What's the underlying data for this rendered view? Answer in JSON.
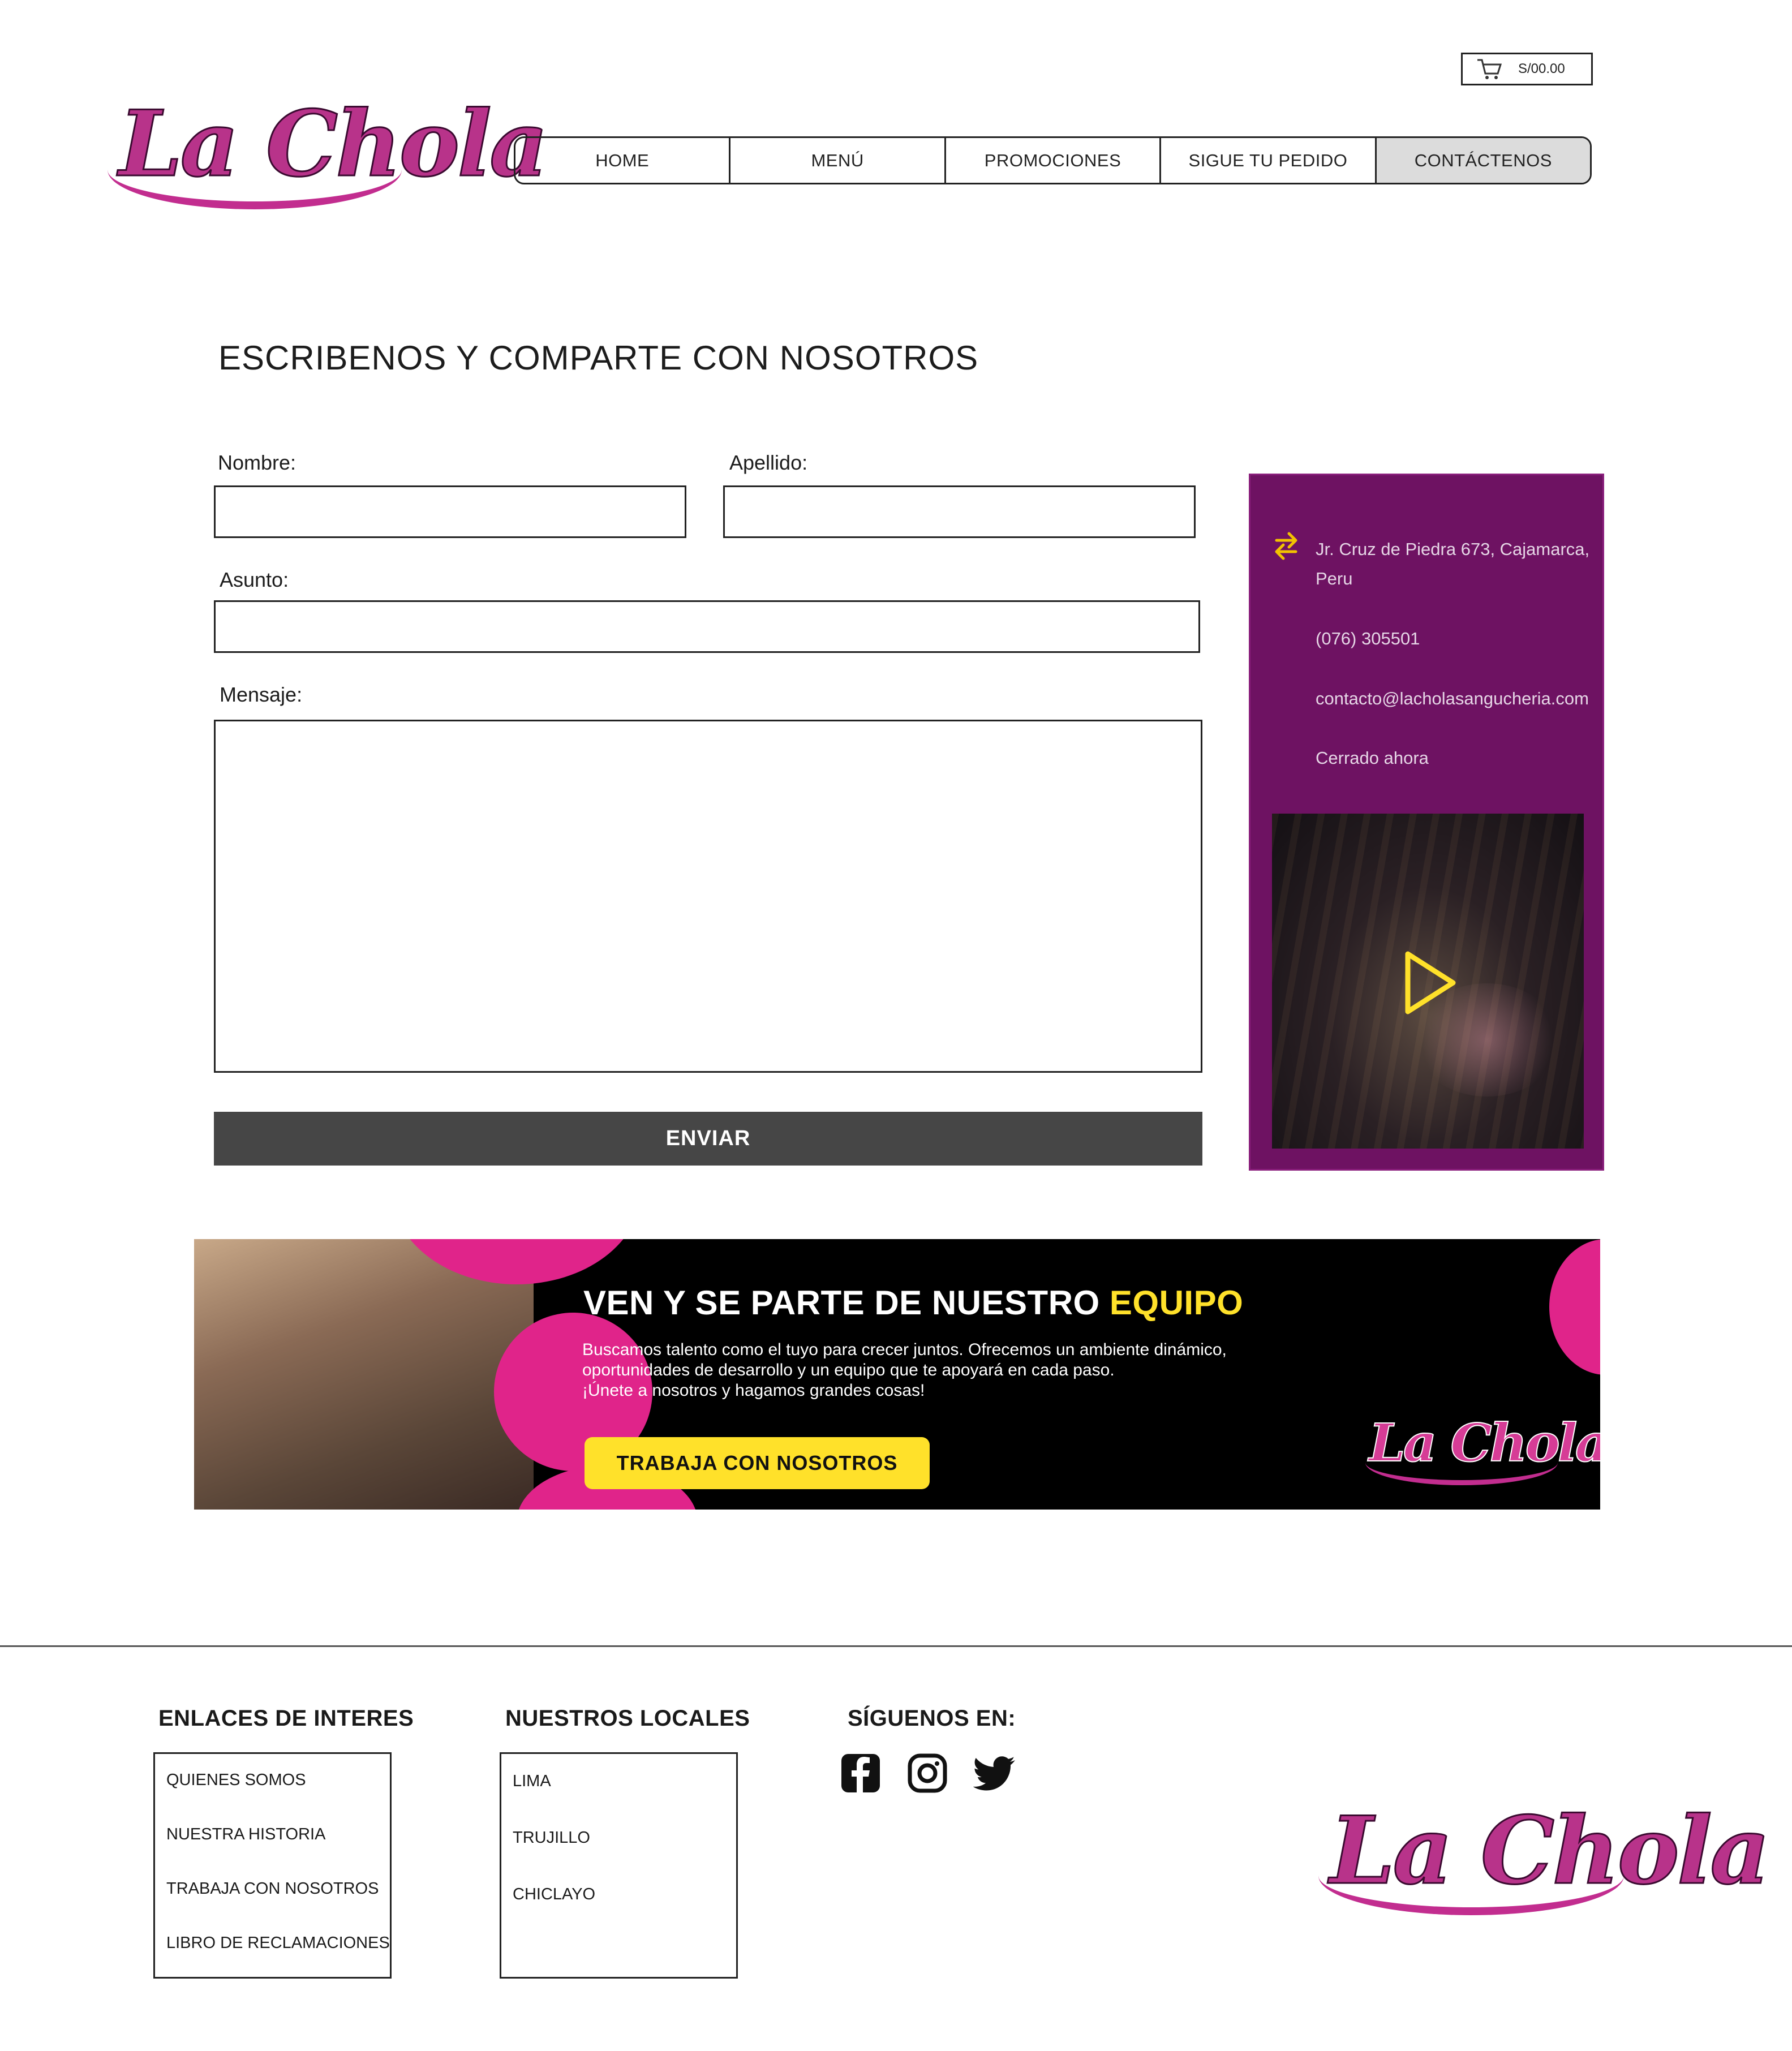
{
  "brand": {
    "logo_text": "La Chola"
  },
  "cart": {
    "amount": "S/00.00",
    "icon": "cart-icon"
  },
  "nav": {
    "items": [
      {
        "label": "HOME"
      },
      {
        "label": "MENÚ"
      },
      {
        "label": "PROMOCIONES"
      },
      {
        "label": "SIGUE TU PEDIDO"
      },
      {
        "label": "CONTÁCTENOS"
      }
    ],
    "active_index": 4
  },
  "form": {
    "title": "ESCRIBENOS Y COMPARTE CON NOSOTROS",
    "first_name_label": "Nombre:",
    "first_name_value": "",
    "last_name_label": "Apellido:",
    "last_name_value": "",
    "subject_label": "Asunto:",
    "subject_value": "",
    "message_label": "Mensaje:",
    "message_value": "",
    "submit_label": "ENVIAR"
  },
  "info": {
    "address_line1": "Jr. Cruz de Piedra 673, Cajamarca,",
    "address_line2": "Peru",
    "phone": "(076) 305501",
    "email": "contacto@lacholasangucheria.com",
    "status": "Cerrado ahora",
    "address_icon": "directions-icon",
    "video_icon": "play-icon"
  },
  "banner": {
    "title_part1": "VEN Y SE PARTE DE NUESTRO ",
    "title_highlight": "EQUIPO",
    "text_line1": "Buscamos talento como el tuyo para crecer juntos. Ofrecemos un ambiente dinámico,",
    "text_line2": "oportunidades de desarrollo y un equipo que te apoyará en cada paso.",
    "text_line3": "¡Únete a nosotros y hagamos grandes cosas!",
    "button_label": "TRABAJA CON NOSOTROS"
  },
  "footer": {
    "links_heading": "ENLACES DE INTERES",
    "links": [
      "QUIENES SOMOS",
      "NUESTRA HISTORIA",
      "TRABAJA CON NOSOTROS",
      "LIBRO DE RECLAMACIONES"
    ],
    "locations_heading": "NUESTROS LOCALES",
    "locations": [
      "LIMA",
      "TRUJILLO",
      "CHICLAYO"
    ],
    "social_heading": "SÍGUENOS EN:",
    "social_icons": [
      "facebook-icon",
      "instagram-icon",
      "twitter-icon"
    ]
  },
  "colors": {
    "panel_purple": "#6e1262",
    "brand_pink": "#e0248a",
    "accent_yellow": "#ffe12a",
    "button_dark": "#464646"
  }
}
